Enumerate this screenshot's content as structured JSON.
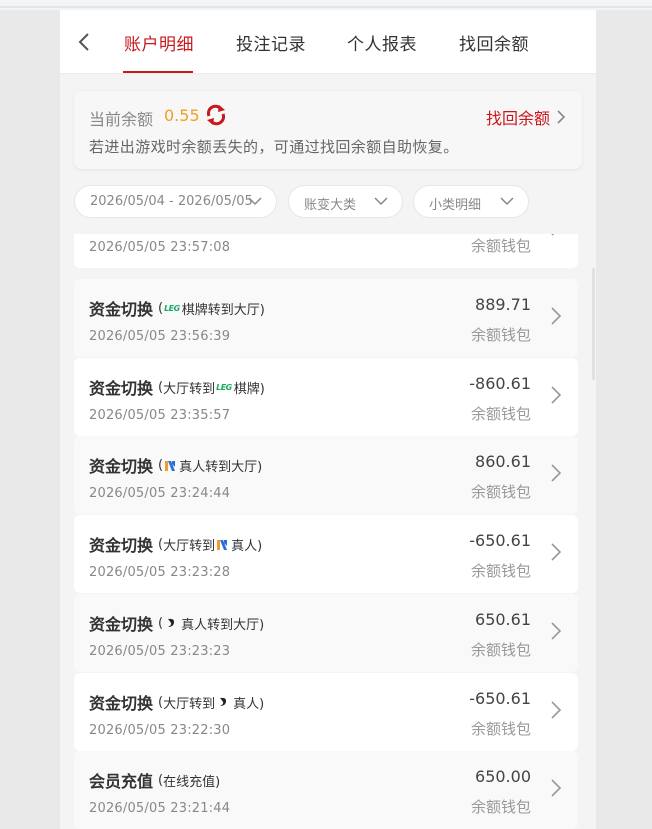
{
  "tabs": [
    {
      "label": "账户明细",
      "active": true
    },
    {
      "label": "投注记录",
      "active": false
    },
    {
      "label": "个人报表",
      "active": false
    },
    {
      "label": "找回余额",
      "active": false
    }
  ],
  "balance": {
    "label": "当前余额",
    "value": "0.55",
    "recover_label": "找回余额",
    "hint": "若进出游戏时余额丢失的，可通过找回余额自助恢复。"
  },
  "filters": {
    "date_range": "2026/05/04 - 2026/05/05",
    "category": "账变大类",
    "subcategory": "小类明细"
  },
  "partial_row": {
    "time": "2026/05/05 23:57:08",
    "wallet": "余额钱包"
  },
  "rows": [
    {
      "title": "资金切换",
      "desc_open": "(",
      "desc_before": "",
      "logo": "leg-logo",
      "desc_after": "棋牌转到大厅)",
      "time": "2026/05/05 23:56:39",
      "amount": "889.71",
      "wallet": "余额钱包"
    },
    {
      "title": "资金切换",
      "desc_open": "(",
      "desc_before": "大厅转到",
      "logo": "leg-logo",
      "desc_after": "棋牌)",
      "time": "2026/05/05 23:35:57",
      "amount": "-860.61",
      "wallet": "余额钱包"
    },
    {
      "title": "资金切换",
      "desc_open": "(",
      "desc_before": "",
      "logo": "n-logo",
      "desc_after": "真人转到大厅)",
      "time": "2026/05/05 23:24:44",
      "amount": "860.61",
      "wallet": "余额钱包"
    },
    {
      "title": "资金切换",
      "desc_open": "(",
      "desc_before": "大厅转到",
      "logo": "n-logo",
      "desc_after": "真人)",
      "time": "2026/05/05 23:23:28",
      "amount": "-650.61",
      "wallet": "余额钱包"
    },
    {
      "title": "资金切换",
      "desc_open": "(",
      "desc_before": "",
      "logo": "swirl-logo",
      "desc_after": "真人转到大厅)",
      "time": "2026/05/05 23:23:23",
      "amount": "650.61",
      "wallet": "余额钱包"
    },
    {
      "title": "资金切换",
      "desc_open": "(",
      "desc_before": "大厅转到",
      "logo": "swirl-logo",
      "desc_after": "真人)",
      "time": "2026/05/05 23:22:30",
      "amount": "-650.61",
      "wallet": "余额钱包"
    },
    {
      "title": "会员充值",
      "desc_open": "(",
      "desc_before": "在线充值)",
      "logo": "",
      "desc_after": "",
      "time": "2026/05/05 23:21:44",
      "amount": "650.00",
      "wallet": "余额钱包"
    }
  ],
  "logos": {
    "leg_text": "LEG"
  },
  "colors": {
    "accent": "#c9171e",
    "balance": "#f0a020",
    "leg_green": "#1ea86a"
  }
}
